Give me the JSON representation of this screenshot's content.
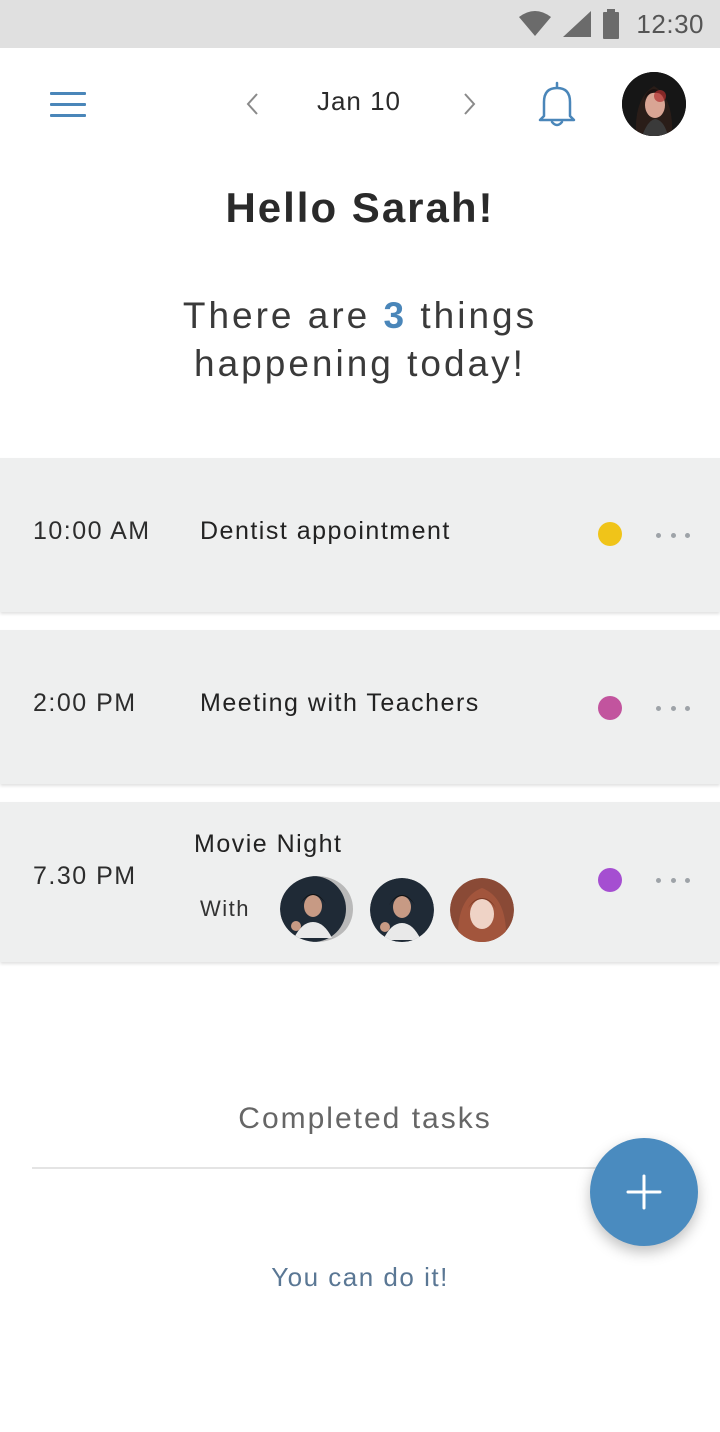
{
  "status_bar": {
    "time": "12:30",
    "icons": [
      "wifi-icon",
      "signal-icon",
      "battery-icon"
    ]
  },
  "header": {
    "date": "Jan 10",
    "icons": [
      "menu-icon",
      "chevron-left-icon",
      "chevron-right-icon",
      "bell-icon",
      "avatar"
    ]
  },
  "greeting": "Hello Sarah!",
  "summary": {
    "prefix": "There are",
    "count": "3",
    "suffix": "things",
    "line2": "happening today!"
  },
  "events": [
    {
      "time": "10:00 AM",
      "title": "Dentist appointment",
      "color": "#f0c419"
    },
    {
      "time": "2:00 PM",
      "title": "Meeting with Teachers",
      "color": "#c2549e"
    },
    {
      "time": "7.30 PM",
      "title": "Movie Night",
      "with_label": "With",
      "color": "#a54ed1"
    }
  ],
  "completed": {
    "title": "Completed tasks",
    "message": "You can do it!"
  },
  "colors": {
    "accent": "#4a86b9",
    "card_bg": "#eeefef",
    "fab": "#4a8bbf"
  }
}
